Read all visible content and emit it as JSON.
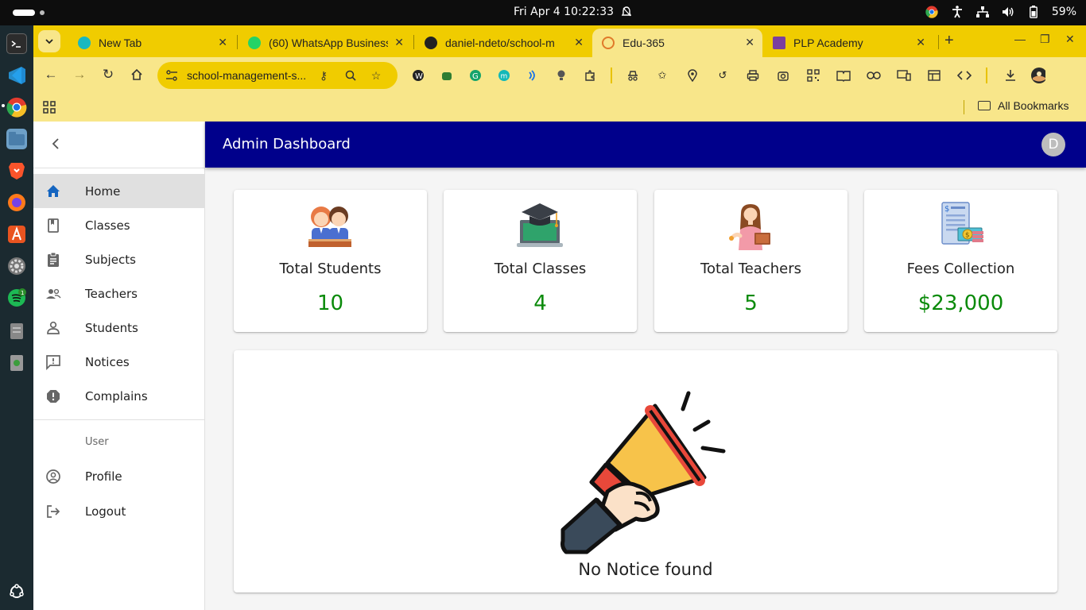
{
  "os": {
    "clock": "Fri Apr 4  10:22:33",
    "battery": "59%"
  },
  "browser": {
    "tabs": [
      {
        "title": "New Tab",
        "icon": "meet-icon",
        "active": false
      },
      {
        "title": "(60) WhatsApp Business",
        "icon": "whatsapp-icon",
        "active": false
      },
      {
        "title": "daniel-ndeto/school-m",
        "icon": "github-icon",
        "active": false
      },
      {
        "title": "Edu-365",
        "icon": "edu-icon",
        "active": true
      },
      {
        "title": "PLP Academy",
        "icon": "plp-icon",
        "active": false
      }
    ],
    "url": "school-management-s...",
    "all_bookmarks": "All Bookmarks"
  },
  "sidebar": {
    "items": [
      {
        "label": "Home",
        "icon": "home-icon",
        "active": true
      },
      {
        "label": "Classes",
        "icon": "class-icon"
      },
      {
        "label": "Subjects",
        "icon": "assignment-icon"
      },
      {
        "label": "Teachers",
        "icon": "teachers-icon"
      },
      {
        "label": "Students",
        "icon": "person-icon"
      },
      {
        "label": "Notices",
        "icon": "announcement-icon"
      },
      {
        "label": "Complains",
        "icon": "report-icon"
      }
    ],
    "user_section_label": "User",
    "user_items": [
      {
        "label": "Profile",
        "icon": "account-circle-icon"
      },
      {
        "label": "Logout",
        "icon": "logout-icon"
      }
    ]
  },
  "appbar": {
    "title": "Admin Dashboard",
    "avatar_initial": "D"
  },
  "stats": [
    {
      "title": "Total Students",
      "value": "10",
      "icon": "students-illustration"
    },
    {
      "title": "Total Classes",
      "value": "4",
      "icon": "classes-illustration"
    },
    {
      "title": "Total Teachers",
      "value": "5",
      "icon": "teacher-illustration"
    },
    {
      "title": "Fees Collection",
      "value": "$23,000",
      "icon": "fees-illustration"
    }
  ],
  "notices": {
    "empty_message": "No Notice found"
  },
  "colors": {
    "appbar": "#00008b",
    "stat_value": "#0a8a0a",
    "chrome_theme": "#f0cc00"
  }
}
